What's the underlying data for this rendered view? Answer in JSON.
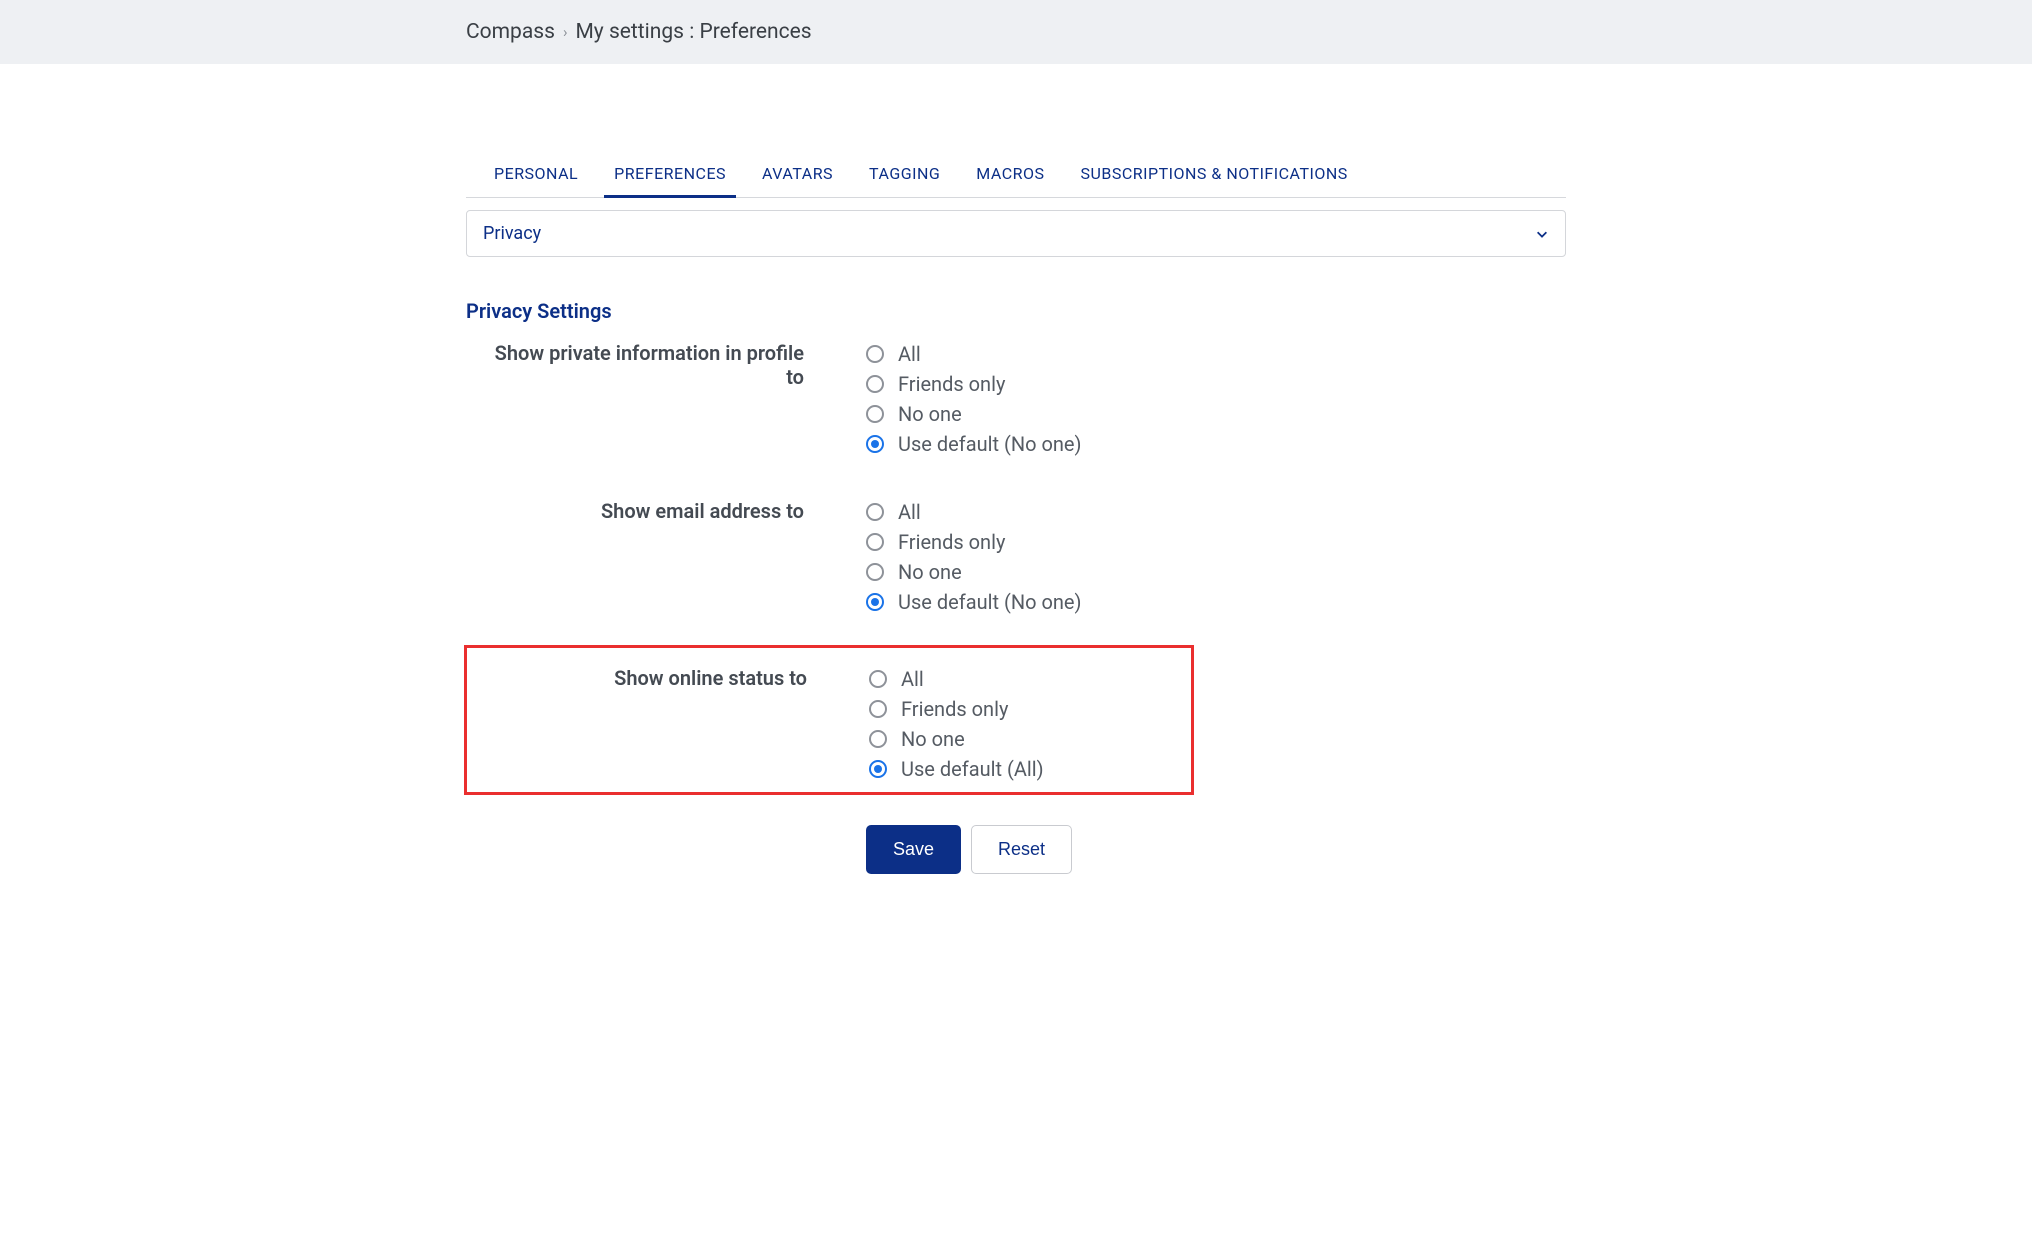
{
  "breadcrumb": {
    "root": "Compass",
    "path": "My settings : Preferences"
  },
  "tabs": [
    {
      "label": "PERSONAL"
    },
    {
      "label": "PREFERENCES"
    },
    {
      "label": "AVATARS"
    },
    {
      "label": "TAGGING"
    },
    {
      "label": "MACROS"
    },
    {
      "label": "SUBSCRIPTIONS & NOTIFICATIONS"
    }
  ],
  "activeTab": 1,
  "dropdown": {
    "selected": "Privacy"
  },
  "section_title": "Privacy Settings",
  "groups": [
    {
      "label": "Show private information in profile to",
      "options": [
        "All",
        "Friends only",
        "No one",
        "Use default (No one)"
      ],
      "selected": 3,
      "highlight": false
    },
    {
      "label": "Show email address to",
      "options": [
        "All",
        "Friends only",
        "No one",
        "Use default (No one)"
      ],
      "selected": 3,
      "highlight": false
    },
    {
      "label": "Show online status to",
      "options": [
        "All",
        "Friends only",
        "No one",
        "Use default (All)"
      ],
      "selected": 3,
      "highlight": true
    }
  ],
  "buttons": {
    "save": "Save",
    "reset": "Reset"
  }
}
